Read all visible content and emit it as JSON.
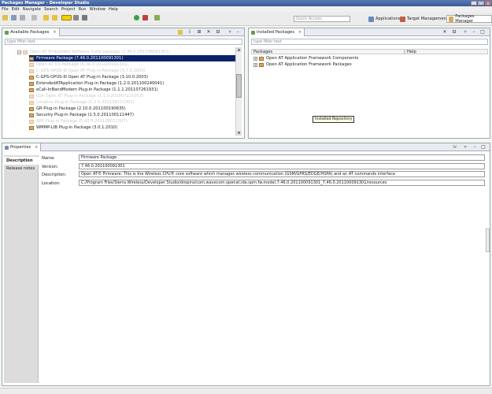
{
  "window": {
    "title": "Packages Manager - Developer Studio",
    "minimize": "_",
    "maximize": "□",
    "close": "×"
  },
  "menu": [
    "File",
    "Edit",
    "Navigate",
    "Search",
    "Project",
    "Run",
    "Window",
    "Help"
  ],
  "quick_access": {
    "placeholder": "Quick Access"
  },
  "perspectives": [
    "Applications",
    "Target Management",
    "Packages Manager"
  ],
  "available": {
    "tab_label": "Available Packages",
    "filter_placeholder": "type filter text",
    "rows": [
      "Open AT Embedded Software Suite package (2.36.0.201108081301)",
      "Firmware Package (7.46.0.201100091301)",
      "Open AT OS Package (6.36.0.201100091301)",
      "C-GPS-OPUS-III Open AT Plug-in Package (3.7.0.2003)",
      "C-GPS-OPUS-III Open AT Plug-in Package (3.10.0.2003)",
      "ExtendedATApplication Plug-in Package (1.2.0.201100240041)",
      "eCall-InBandModem Plug-in Package (1.1.1.201107261931)",
      "LUA Open AT Plug-in Package (1.1.0.201007121052)",
      "Location Plug-in Package (1.2.0.201109111301)",
      "GR Plug-in Package (2.10.0.201100190635)",
      "Security Plug-in Package (1.5.0.201100111447)",
      "WIP Plug-in Package (5.42.0.201108011307)",
      "WMMP-LIB Plug-in Package (3.0.1.2010)"
    ]
  },
  "installed": {
    "tab_label": "Installed Packages",
    "filter_placeholder": "type filter text",
    "columns": [
      "Packages",
      "Help"
    ],
    "rows": [
      "Open AT Application Framework Components",
      "Open AT Application Framework Packages"
    ],
    "tooltip": "Installed Repository"
  },
  "properties": {
    "tab_label": "Properties",
    "side_tabs": [
      "Description",
      "Release notes"
    ],
    "name_label": "Name:",
    "name_value": "Firmware Package",
    "version_label": "Version:",
    "version_value": "7.46.0.201100091301",
    "description_label": "Description:",
    "description_value": "Open AT® Firmware: This is the Wireless CPU® core software which manages wireless communication (GSM/GPRS/EDGE/HSPA) and an AT commands interface",
    "location_label": "Location:",
    "location_value": "C:/Program Files/Sierra Wireless/Developer Studio/dropins/com.wavecom.openat.ide.spm.fw.model.7.46.0.201100091301_7.46.0.201100091301/resources"
  },
  "colors": {
    "selection": "#0a246a",
    "title_bar": "#3a5a98",
    "package_icon": "#d8a860",
    "tooltip": "#ffffe1"
  }
}
